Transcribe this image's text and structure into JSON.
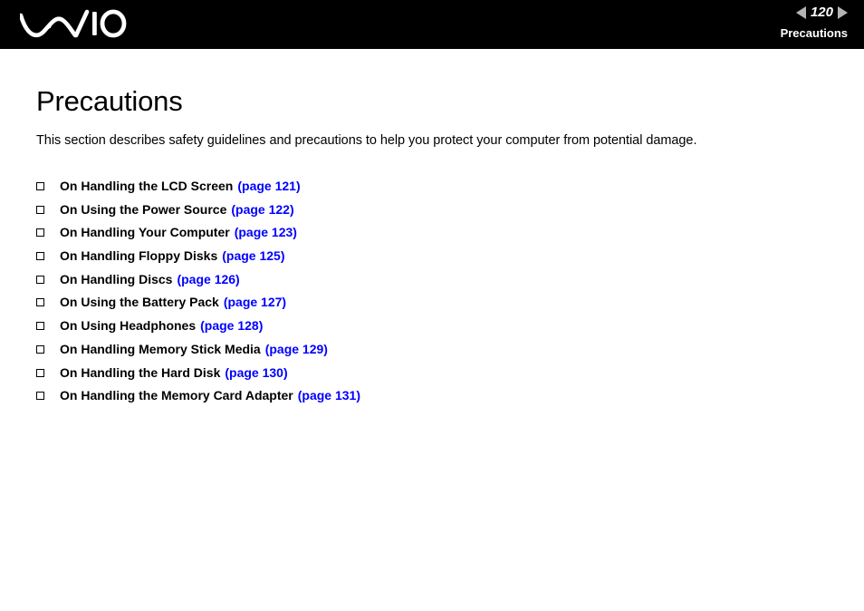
{
  "header": {
    "logo_alt": "VAIO",
    "prev_arrow": "◀",
    "next_arrow": "▶",
    "page_number": "120",
    "section_title": "Precautions"
  },
  "page": {
    "title": "Precautions",
    "intro": "This section describes safety guidelines and precautions to help you protect your computer from potential damage.",
    "bullet_glyph": "❑"
  },
  "toc": {
    "items": [
      {
        "label": "On Handling the LCD Screen",
        "page_ref": "(page 121)"
      },
      {
        "label": "On Using the Power Source",
        "page_ref": "(page 122)"
      },
      {
        "label": "On Handling Your Computer",
        "page_ref": "(page 123)"
      },
      {
        "label": "On Handling Floppy Disks",
        "page_ref": "(page 125)"
      },
      {
        "label": "On Handling Discs",
        "page_ref": "(page 126)"
      },
      {
        "label": "On Using the Battery Pack",
        "page_ref": "(page 127)"
      },
      {
        "label": "On Using Headphones",
        "page_ref": "(page 128)"
      },
      {
        "label": "On Handling Memory Stick Media",
        "page_ref": "(page 129)"
      },
      {
        "label": "On Handling the Hard Disk",
        "page_ref": "(page 130)"
      },
      {
        "label": "On Handling the Memory Card Adapter",
        "page_ref": "(page 131)"
      }
    ]
  },
  "colors": {
    "header_background": "#000000",
    "page_background": "#ffffff",
    "link": "#0000ff",
    "text": "#000000",
    "arrow": "#b4b4b4"
  }
}
